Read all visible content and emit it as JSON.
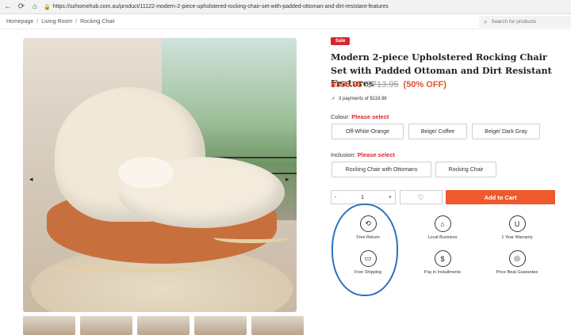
{
  "browser": {
    "url": "https://ozhomehub.com.au/product/11122-modern-2-piece-upholstered-rocking-chair-set-with-padded-ottoman-and-dirt-resistant-features"
  },
  "breadcrumb": [
    "Homepage",
    "Living Room",
    "Rocking Chair"
  ],
  "search": {
    "placeholder": "Search for products"
  },
  "product": {
    "badge": "Sale",
    "title": "Modern 2-piece Upholstered Rocking Chair Set with Padded Ottoman and Dirt Resistant Features",
    "price": "$356.95",
    "old_price": "$713.95",
    "discount": "(50% OFF)",
    "installment": "3 payments of $118.98"
  },
  "colour": {
    "label": "Colour:",
    "required": "Please select",
    "options": [
      "Off-White-Orange",
      "Beige/ Coffee",
      "Beige/ Dark Gray"
    ]
  },
  "inclusion": {
    "label": "Inclusion:",
    "required": "Please select",
    "options": [
      "Rocking Chair with Ottomans",
      "Rocking Chair"
    ]
  },
  "cart": {
    "minus": "-",
    "qty": "1",
    "plus": "+",
    "add_label": "Add to Cart"
  },
  "features": [
    {
      "label": "Free Return",
      "icon": "return-icon"
    },
    {
      "label": "Local Business",
      "icon": "local-business-icon"
    },
    {
      "label": "1 Year Warranty",
      "icon": "warranty-icon"
    },
    {
      "label": "Free Shipping",
      "icon": "truck-icon"
    },
    {
      "label": "Pay in Installments",
      "icon": "installments-icon"
    },
    {
      "label": "Price Beat Guarantee",
      "icon": "price-beat-icon"
    }
  ],
  "colors": {
    "accent": "#ee5a2d",
    "sale": "#d8262f",
    "price": "#e0522c",
    "highlight": "#2c6fc1"
  }
}
